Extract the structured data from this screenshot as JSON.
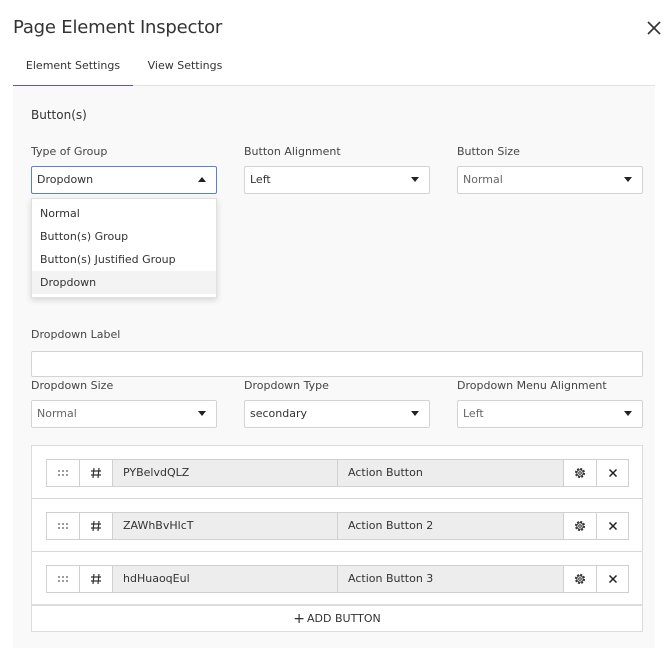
{
  "dialog": {
    "title": "Page Element Inspector"
  },
  "tabs": [
    {
      "label": "Element Settings",
      "active": true
    },
    {
      "label": "View Settings",
      "active": false
    }
  ],
  "section": {
    "title": "Button(s)"
  },
  "group_type": {
    "label": "Type of Group",
    "value": "Dropdown",
    "expanded": true,
    "options": [
      "Normal",
      "Button(s) Group",
      "Button(s) Justified Group",
      "Dropdown"
    ]
  },
  "alignment": {
    "label": "Button Alignment",
    "value": "Left"
  },
  "size": {
    "label": "Button Size",
    "value": "Normal"
  },
  "dropdown_label": {
    "label": "Dropdown Label",
    "value": ""
  },
  "dropdown_size": {
    "label": "Dropdown Size",
    "value": "Normal"
  },
  "dropdown_type": {
    "label": "Dropdown Type",
    "value": "secondary"
  },
  "menu_alignment": {
    "label": "Dropdown Menu Alignment",
    "value": "Left"
  },
  "buttons": [
    {
      "id": "PYBelvdQLZ",
      "label": "Action Button"
    },
    {
      "id": "ZAWhBvHlcT",
      "label": "Action Button 2"
    },
    {
      "id": "hdHuaoqEul",
      "label": "Action Button 3"
    }
  ],
  "add_button": {
    "label": "ADD BUTTON"
  },
  "icons": {
    "close": "close-icon",
    "drag": "drag-handle-icon",
    "hash": "hash-icon",
    "settings": "gear-icon",
    "remove": "remove-icon",
    "plus": "plus-icon"
  },
  "colors": {
    "accent": "#6a4fb5",
    "focus_border": "#5c7fd6",
    "panel_bg": "#f9f9f9"
  }
}
